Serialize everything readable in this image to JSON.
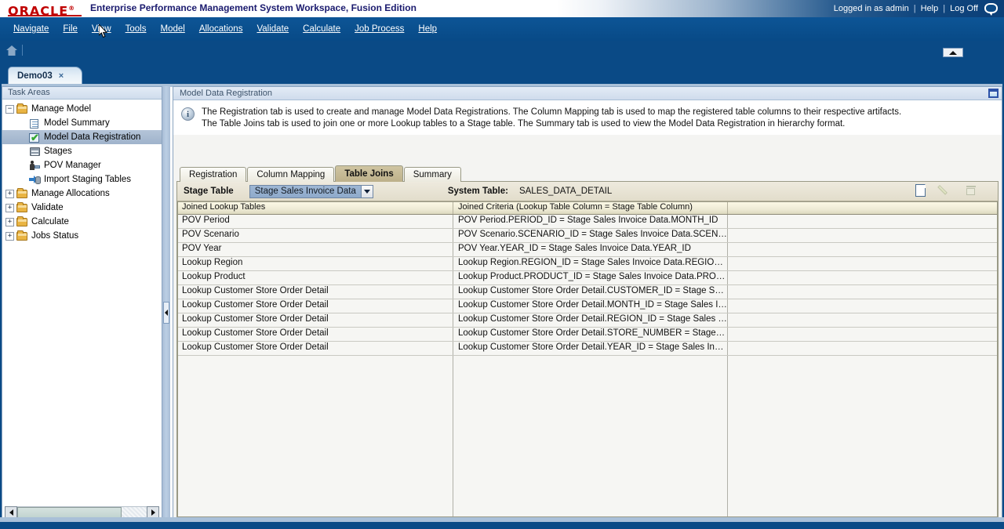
{
  "brand": {
    "logo": "ORACLE",
    "tm": "®",
    "title": "Enterprise Performance Management System Workspace, Fusion Edition",
    "logged_in": "Logged in as admin",
    "help": "Help",
    "log_off": "Log Off",
    "separator": "|"
  },
  "menubar": {
    "items": [
      {
        "label": "Navigate",
        "accel": "N"
      },
      {
        "label": "File",
        "accel": "F"
      },
      {
        "label": "View",
        "accel": "V"
      },
      {
        "label": "Tools",
        "accel": "T"
      },
      {
        "label": "Model",
        "accel": "M"
      },
      {
        "label": "Allocations",
        "accel": "A"
      },
      {
        "label": "Validate",
        "accel": "V"
      },
      {
        "label": "Calculate",
        "accel": "C"
      },
      {
        "label": "Job Process",
        "accel": "J"
      },
      {
        "label": "Help",
        "accel": "H"
      }
    ]
  },
  "doc_tab": {
    "label": "Demo03",
    "close": "×"
  },
  "sidebar": {
    "header": "Task Areas",
    "items": [
      {
        "label": "Manage Model",
        "icon": "folder-icon",
        "expander": "−",
        "depth": 0,
        "selected": false
      },
      {
        "label": "Model Summary",
        "icon": "document-icon",
        "expander": "",
        "depth": 1,
        "selected": false
      },
      {
        "label": "Model Data Registration",
        "icon": "checkmark-icon",
        "expander": "",
        "depth": 1,
        "selected": true
      },
      {
        "label": "Stages",
        "icon": "stages-icon",
        "expander": "",
        "depth": 1,
        "selected": false
      },
      {
        "label": "POV Manager",
        "icon": "pov-manager-icon",
        "expander": "",
        "depth": 1,
        "selected": false
      },
      {
        "label": "Import Staging Tables",
        "icon": "import-icon",
        "expander": "",
        "depth": 1,
        "selected": false
      },
      {
        "label": "Manage Allocations",
        "icon": "folder-icon",
        "expander": "+",
        "depth": 0,
        "selected": false
      },
      {
        "label": "Validate",
        "icon": "folder-icon",
        "expander": "+",
        "depth": 0,
        "selected": false
      },
      {
        "label": "Calculate",
        "icon": "folder-icon",
        "expander": "+",
        "depth": 0,
        "selected": false
      },
      {
        "label": "Jobs Status",
        "icon": "folder-icon",
        "expander": "+",
        "depth": 0,
        "selected": false
      }
    ]
  },
  "content": {
    "header_title": "Model Data Registration",
    "info_icon": "i",
    "info_line1": "The Registration tab is used to create and manage Model Data Registrations.  The Column Mapping tab is used to map the registered table columns to their respective artifacts.",
    "info_line2": "The Table Joins tab is used to join one or more Lookup tables to a Stage table.  The Summary tab is used to view the Model Data Registration in hierarchy format.",
    "tabs": [
      {
        "label": "Registration",
        "active": false
      },
      {
        "label": "Column Mapping",
        "active": false
      },
      {
        "label": "Table Joins",
        "active": true
      },
      {
        "label": "Summary",
        "active": false
      }
    ],
    "toolbar": {
      "stage_table_label": "Stage Table",
      "stage_table_value": "Stage Sales Invoice Data",
      "system_table_label": "System Table:",
      "system_table_value": "SALES_DATA_DETAIL",
      "icons": [
        {
          "name": "new-icon",
          "enabled": true
        },
        {
          "name": "edit-icon",
          "enabled": false
        },
        {
          "name": "delete-icon",
          "enabled": false
        }
      ]
    },
    "grid": {
      "columns": [
        "Joined Lookup Tables",
        "Joined Criteria (Lookup Table Column = Stage Table Column)",
        ""
      ],
      "rows": [
        [
          "POV Period",
          "POV Period.PERIOD_ID = Stage Sales Invoice Data.MONTH_ID",
          ""
        ],
        [
          "POV Scenario",
          "POV Scenario.SCENARIO_ID = Stage Sales Invoice Data.SCENARIO…",
          ""
        ],
        [
          "POV Year",
          "POV Year.YEAR_ID = Stage Sales Invoice Data.YEAR_ID",
          ""
        ],
        [
          "Lookup Region",
          "Lookup Region.REGION_ID = Stage Sales Invoice Data.REGION_ID",
          ""
        ],
        [
          "Lookup Product",
          "Lookup Product.PRODUCT_ID = Stage Sales Invoice Data.PRODUCT…",
          ""
        ],
        [
          "Lookup Customer Store Order Detail",
          "Lookup Customer Store Order Detail.CUSTOMER_ID = Stage Sales I…",
          ""
        ],
        [
          "Lookup Customer Store Order Detail",
          "Lookup Customer Store Order Detail.MONTH_ID = Stage Sales Invoi…",
          ""
        ],
        [
          "Lookup Customer Store Order Detail",
          "Lookup Customer Store Order Detail.REGION_ID = Stage Sales Invoi…",
          ""
        ],
        [
          "Lookup Customer Store Order Detail",
          "Lookup Customer Store Order Detail.STORE_NUMBER = Stage Sales …",
          ""
        ],
        [
          "Lookup Customer Store Order Detail",
          "Lookup Customer Store Order Detail.YEAR_ID = Stage Sales Invoice …",
          ""
        ]
      ]
    }
  },
  "colors": {
    "brand_red": "#c00000",
    "header_blue": "#0a4d8c",
    "tab_active": "#bdb08a",
    "selection": "#a9bdd6"
  }
}
